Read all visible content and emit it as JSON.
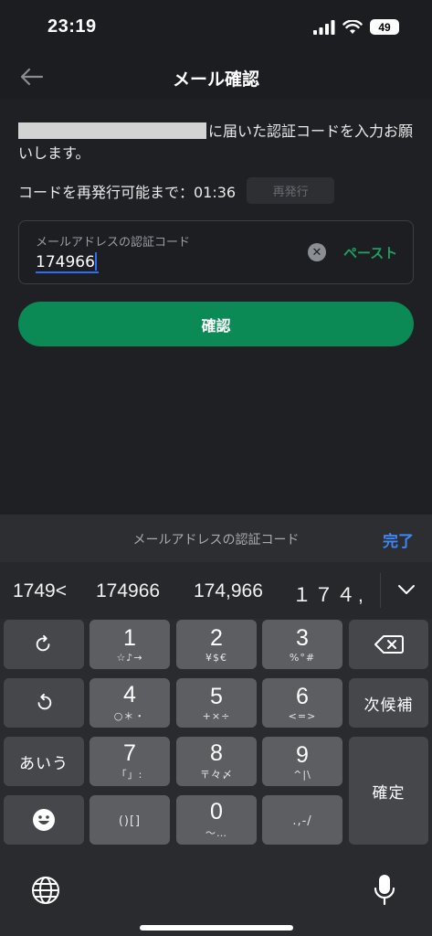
{
  "status": {
    "time": "23:19",
    "battery": "49"
  },
  "nav": {
    "title": "メール確認"
  },
  "content": {
    "description": "に届いた認証コードを入力お願いします。",
    "reissue_text": "コードを再発行可能まで：01:36",
    "reissue_button": "再発行",
    "input_label": "メールアドレスの認証コード",
    "input_value": "174966",
    "paste_label": "ペースト",
    "confirm_button": "確認"
  },
  "keyboard": {
    "header_title": "メールアドレスの認証コード",
    "done_label": "完了",
    "suggestions": [
      "1749<",
      "174966",
      "174,966",
      "１７４,"
    ],
    "keys": {
      "k1": {
        "main": "1",
        "sub": "☆♪→"
      },
      "k2": {
        "main": "2",
        "sub": "¥$€"
      },
      "k3": {
        "main": "3",
        "sub": "%°#"
      },
      "k4": {
        "main": "4",
        "sub": "○＊・"
      },
      "k5": {
        "main": "5",
        "sub": "+×÷"
      },
      "k6": {
        "main": "6",
        "sub": "<=>"
      },
      "k7": {
        "main": "7",
        "sub": "「」:"
      },
      "k8": {
        "main": "8",
        "sub": "〒々〆"
      },
      "k9": {
        "main": "9",
        "sub": "^|\\"
      },
      "k0": {
        "main": "0",
        "sub": "〜…"
      },
      "paren": {
        "main": "()[]"
      },
      "punct": {
        "main": ".,-/"
      },
      "candidates": "次候補",
      "kana": "あいう",
      "enter": "確定"
    }
  }
}
